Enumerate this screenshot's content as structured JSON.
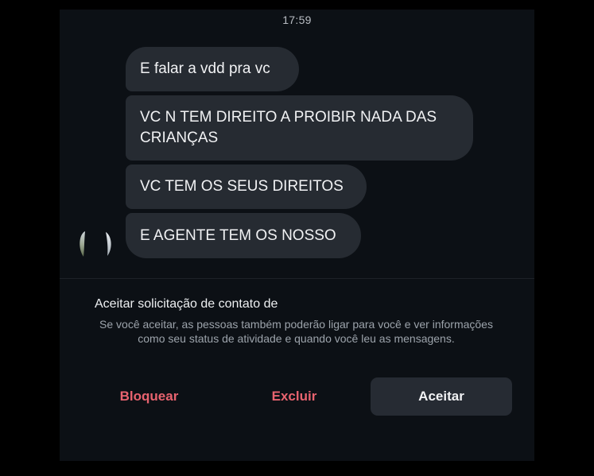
{
  "status": {
    "time": "17:59"
  },
  "messages": [
    {
      "text": "E falar a vdd pra vc"
    },
    {
      "text": "VC N TEM DIREITO A PROIBIR NADA DAS CRIANÇAS"
    },
    {
      "text": "VC TEM OS SEUS DIREITOS"
    },
    {
      "text": "E AGENTE TEM OS NOSSO"
    }
  ],
  "request": {
    "title": "Aceitar solicitação de contato de",
    "description": "Se você aceitar, as pessoas também poderão ligar para você e ver informações como seu status de atividade e quando você leu as mensagens."
  },
  "actions": {
    "block_label": "Bloquear",
    "delete_label": "Excluir",
    "accept_label": "Aceitar"
  },
  "colors": {
    "background": "#0c1015",
    "bubble": "#262b32",
    "destructive": "#e8636f",
    "accept_button": "#262b33"
  }
}
